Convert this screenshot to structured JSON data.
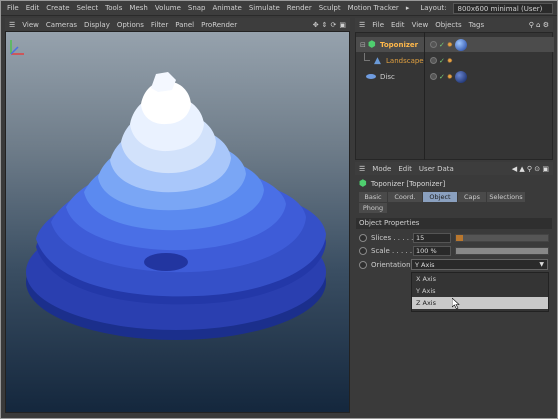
{
  "menubar": {
    "items": [
      "File",
      "Edit",
      "Create",
      "Select",
      "Tools",
      "Mesh",
      "Volume",
      "Snap",
      "Animate",
      "Simulate",
      "Render",
      "Sculpt",
      "Motion Tracker"
    ],
    "layout_label": "Layout:",
    "layout_value": "800x600 minimal (User)"
  },
  "viewport": {
    "menu": [
      "View",
      "Cameras",
      "Display",
      "Options",
      "Filter",
      "Panel",
      "ProRender"
    ]
  },
  "object_manager": {
    "menu": [
      "File",
      "Edit",
      "View",
      "Objects",
      "Tags"
    ],
    "objects": [
      {
        "name": "Toponizer",
        "color": "#ffb84a"
      },
      {
        "name": "Landscape",
        "color": "#e0a040"
      },
      {
        "name": "Disc",
        "color": "#cfcfcf"
      }
    ]
  },
  "attribute_manager": {
    "menu": [
      "Mode",
      "Edit",
      "User Data"
    ],
    "object_title": "Toponizer [Toponizer]",
    "tabs": [
      "Basic",
      "Coord.",
      "Object",
      "Caps",
      "Selections",
      "Phong"
    ],
    "active_tab": "Object",
    "section_title": "Object Properties",
    "slices": {
      "label": "Slices . . . . .",
      "value": "15",
      "fraction": 0.08
    },
    "scale": {
      "label": "Scale . . . . .",
      "value": "100 %",
      "fraction": 1.0
    },
    "orientation": {
      "label": "Orientation",
      "value": "Y Axis",
      "options": [
        "X Axis",
        "Y Axis",
        "Z Axis"
      ],
      "highlighted": "Z Axis"
    }
  },
  "colors": {
    "accent": "#8aa0bf",
    "selection_text": "#ffb84a",
    "slider_fill": "#b9772e"
  }
}
